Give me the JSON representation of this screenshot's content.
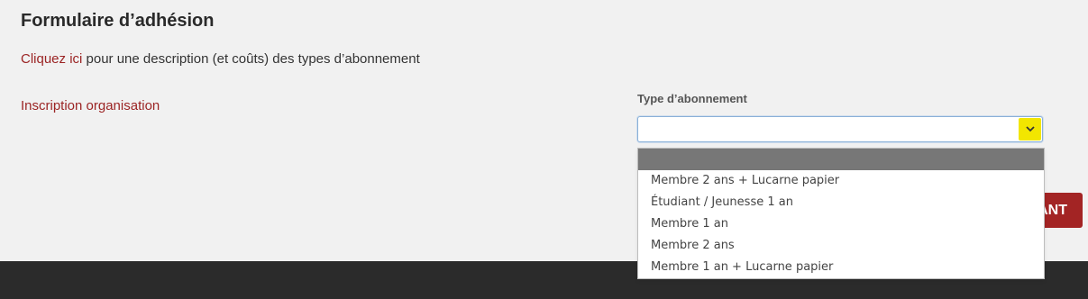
{
  "form": {
    "title": "Formulaire d’adhésion",
    "description_link": "Cliquez ici",
    "description_text": " pour une description (et coûts) des types d’abonnement",
    "org_link": "Inscription organisation"
  },
  "subscription": {
    "label": "Type d’abonnement",
    "selected": "",
    "options": [
      "",
      "Membre 2 ans + Lucarne papier",
      "Étudiant / Jeunesse 1 an",
      "Membre 1 an",
      "Membre 2 ans",
      "Membre 1 an + Lucarne papier"
    ]
  },
  "actions": {
    "next_label": "SUIVANT"
  },
  "colors": {
    "link": "#9b2424",
    "button": "#a32424",
    "select_arrow": "#f2e600",
    "footer": "#2b2b2b",
    "highlight": "#777777"
  },
  "icons": {
    "select_arrow": "chevron-down-icon"
  }
}
